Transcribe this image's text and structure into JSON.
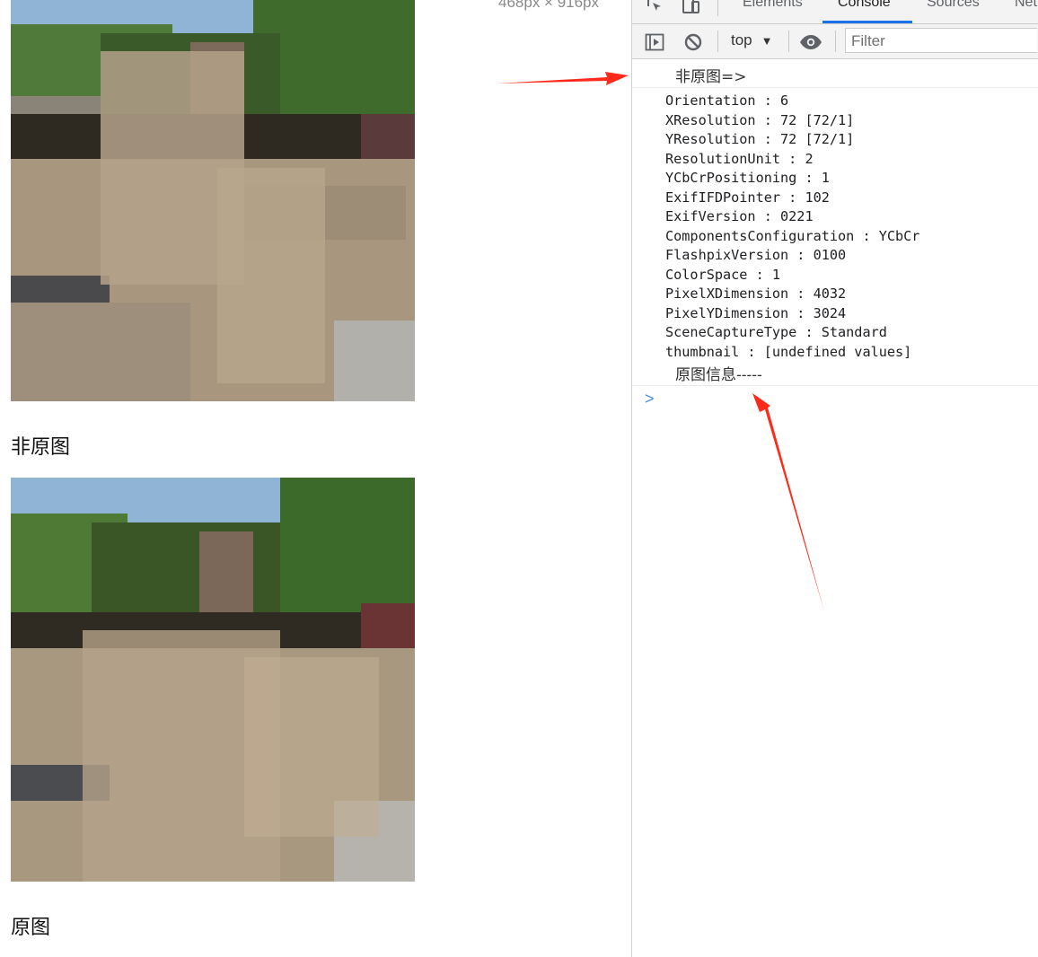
{
  "page": {
    "dimension_label": "468px × 916px",
    "caption_top": "非原图",
    "caption_bottom": "原图"
  },
  "devtools": {
    "tabs": [
      "Elements",
      "Console",
      "Sources",
      "Net"
    ],
    "active_tab": "Console",
    "context": "top",
    "filter_placeholder": "Filter",
    "log_header": "非原图=>",
    "log_footer": "原图信息-----",
    "entries": [
      "Orientation : 6",
      "XResolution : 72 [72/1]",
      "YResolution : 72 [72/1]",
      "ResolutionUnit : 2",
      "YCbCrPositioning : 1",
      "ExifIFDPointer : 102",
      "ExifVersion : 0221",
      "ComponentsConfiguration : YCbCr",
      "FlashpixVersion : 0100",
      "ColorSpace : 1",
      "PixelXDimension : 4032",
      "PixelYDimension : 3024",
      "SceneCaptureType : Standard",
      "thumbnail : [undefined values]"
    ],
    "prompt_symbol": ">"
  },
  "colors": {
    "accent": "#1a73e8",
    "annotation_arrow": "#ff2a1a",
    "prompt": "#4a8ee8"
  },
  "icons": [
    "inspect-element-icon",
    "device-toolbar-icon",
    "sidebar-toggle-icon",
    "clear-console-icon",
    "live-expression-eye-icon",
    "dropdown-caret-icon",
    "console-prompt-chevron-icon"
  ]
}
